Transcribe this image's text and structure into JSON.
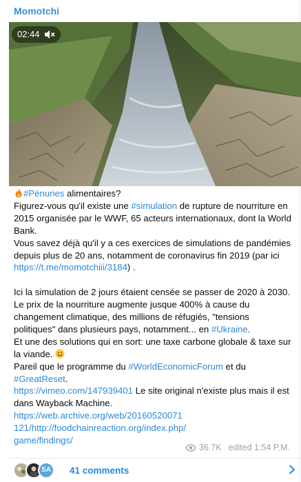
{
  "channel": {
    "name": "Momotchi"
  },
  "video": {
    "duration": "02:44",
    "muted_icon": "speaker-muted-icon"
  },
  "post": {
    "l1_tag": "#Pénuries",
    "l1_rest": " alimentaires?",
    "l2_a": "Figurez-vous qu'il existe une ",
    "l2_tag": "#simulation",
    "l2_b": " de rupture de nourriture en 2015 organisée par le WWF, 65 acteurs internationaux, dont la World Bank.",
    "l3_a": "Vous savez déjà qu'il y a ces exercices de simulations de pandémies depuis plus de 20 ans, notamment de coronavirus fin 2019 (par ici ",
    "l3_link": "https://t.me/momotchiii/3184",
    "l3_b": ") .",
    "l4": "Ici la simulation de 2 jours étaient censée se passer de 2020 à 2030.",
    "l5_a": "Le prix de la nourriture augmente jusque 400% à cause du changement climatique, des millions de réfugiés, \"tensions politiques\" dans plusieurs pays, notamment... en ",
    "l5_tag": "#Ukraine",
    "l5_b": ".",
    "l6": "Et une des solutions qui en sort: une taxe carbone globale & taxe sur la viande. ",
    "l7_a": "Pareil que le programme du ",
    "l7_tag1": "#WorldEconomicForum",
    "l7_b": " et du ",
    "l7_tag2": "#GreatReset",
    "l7_c": ".",
    "l8_link": "https://vimeo.com/147939401",
    "l8_b": "  Le site original n'existe plus mais il est dans Wayback Machine.",
    "l9_link": "https://web.archive.org/web/20160520071121/http://foodchainreaction.org/index.php/game/findings/"
  },
  "meta": {
    "views": "36.7K",
    "edited": "edited 1:54 P.M."
  },
  "comments": {
    "label": "41 comments",
    "avatar_initials": "SA"
  },
  "colors": {
    "accent": "#2b88d8",
    "channel": "#3a8fd1",
    "meta": "#9aa3ab"
  }
}
